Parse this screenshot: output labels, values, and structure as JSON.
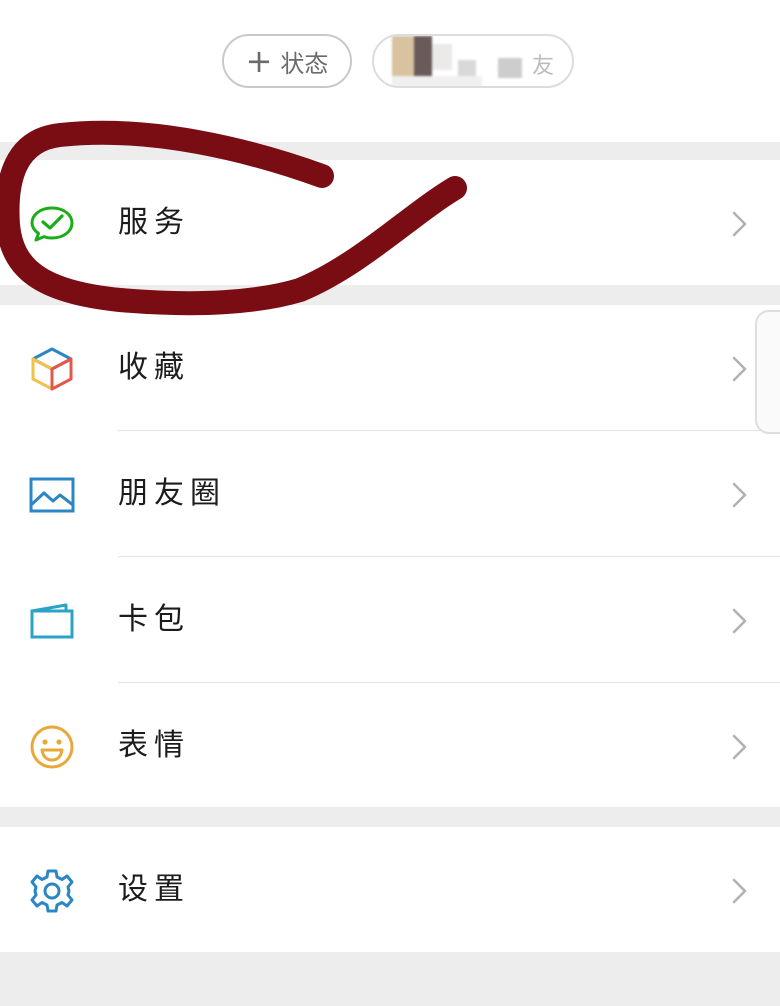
{
  "profile": {
    "status_button": {
      "plus_icon": "+",
      "label": "状态"
    },
    "friend_status_tail": "友"
  },
  "menu": {
    "service": {
      "label": "服务",
      "icon": "wechat-pay-icon"
    },
    "favorites": {
      "label": "收藏",
      "icon": "cube-icon"
    },
    "moments": {
      "label": "朋友圈",
      "icon": "picture-icon"
    },
    "cards": {
      "label": "卡包",
      "icon": "wallet-icon"
    },
    "stickers": {
      "label": "表情",
      "icon": "smiley-icon"
    },
    "settings": {
      "label": "设置",
      "icon": "gear-icon"
    }
  },
  "colors": {
    "background": "#ededed",
    "row_background": "#ffffff",
    "service_icon": "#1aad19",
    "moments_icon": "#2b86c5",
    "cards_icon": "#2aa3c7",
    "stickers_icon": "#e9a93a",
    "settings_icon": "#2b86c5",
    "annotation_marker": "#7a0d14"
  }
}
